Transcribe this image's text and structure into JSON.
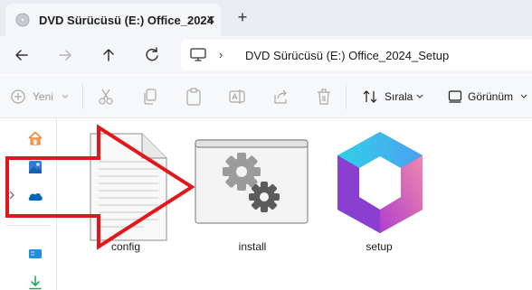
{
  "window": {
    "tab_title": "DVD Sürücüsü (E:) Office_2024",
    "close_symbol": "✕",
    "new_tab_symbol": "+"
  },
  "navigation": {
    "address_path": "DVD Sürücüsü (E:) Office_2024_Setup",
    "separator": "›"
  },
  "toolbar": {
    "new_label": "Yeni",
    "sort_label": "Sırala",
    "view_label": "Görünüm"
  },
  "files": [
    {
      "name": "config",
      "icon": "text-file-icon"
    },
    {
      "name": "install",
      "icon": "gears-app-icon"
    },
    {
      "name": "setup",
      "icon": "office-logo-icon"
    }
  ],
  "sidebar": {
    "items": [
      "home-icon",
      "gallery-icon",
      "onedrive-icon",
      "drive-icon",
      "downloads-icon"
    ]
  },
  "colors": {
    "arrow": "#e3161c",
    "accent": "#0067c0"
  }
}
